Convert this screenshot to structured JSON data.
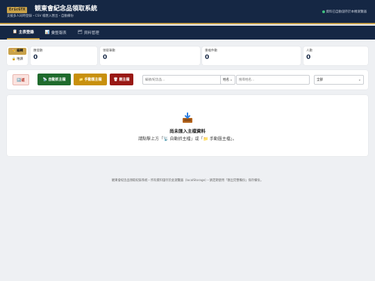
{
  "header": {
    "logo_text": "EricGTX",
    "title": "観東會紀念品領取系統",
    "subtitle": "支援多人同時登錄・CSV 檔匯入匯出・自動備份",
    "save_status": "資料已自動儲存於本機瀏覽器"
  },
  "nav": {
    "tabs": [
      {
        "icon": "📋",
        "label": "主表登錄",
        "active": true
      },
      {
        "icon": "📊",
        "label": "彙整報表",
        "active": false
      },
      {
        "icon": "🗂",
        "label": "資料管理",
        "active": false
      }
    ]
  },
  "mode": {
    "edit_label": "✏️ 編輯",
    "view_label": "🔒 唯讀"
  },
  "stats": [
    {
      "label": "應發數",
      "value": "0"
    },
    {
      "label": "領取筆數",
      "value": "0"
    },
    {
      "label": "重複件數",
      "value": "0"
    },
    {
      "label": "人數",
      "value": "0"
    }
  ],
  "toolbar": {
    "back_label": "🔙返",
    "auto_label": "📡 自動抓主檔",
    "manual_label": "📁 手動匯主檔",
    "delete_label": "🗑 刪主檔",
    "search_placeholder": "編號/紀念品...",
    "field_select": "姓名",
    "search2_placeholder": "搜尋姓名...",
    "status_select": "全部"
  },
  "empty_state": {
    "icon": "📥",
    "title": "尚未匯入主檔資料",
    "hint": "請點擊上方「📡 自動抓主檔」或「📁 手動匯主檔」。"
  },
  "footer": {
    "text": "観東會紀念品領取紀錄系統・所有資料儲存於此瀏覽器（localStorage）・請定期使用「匯出完整備份」保存備份。"
  },
  "colors": {
    "header_bg": "#152744",
    "accent_gold": "#c9a24a",
    "auto_green": "#1f6b2c",
    "manual_amber": "#c8900d",
    "delete_red": "#991915"
  }
}
